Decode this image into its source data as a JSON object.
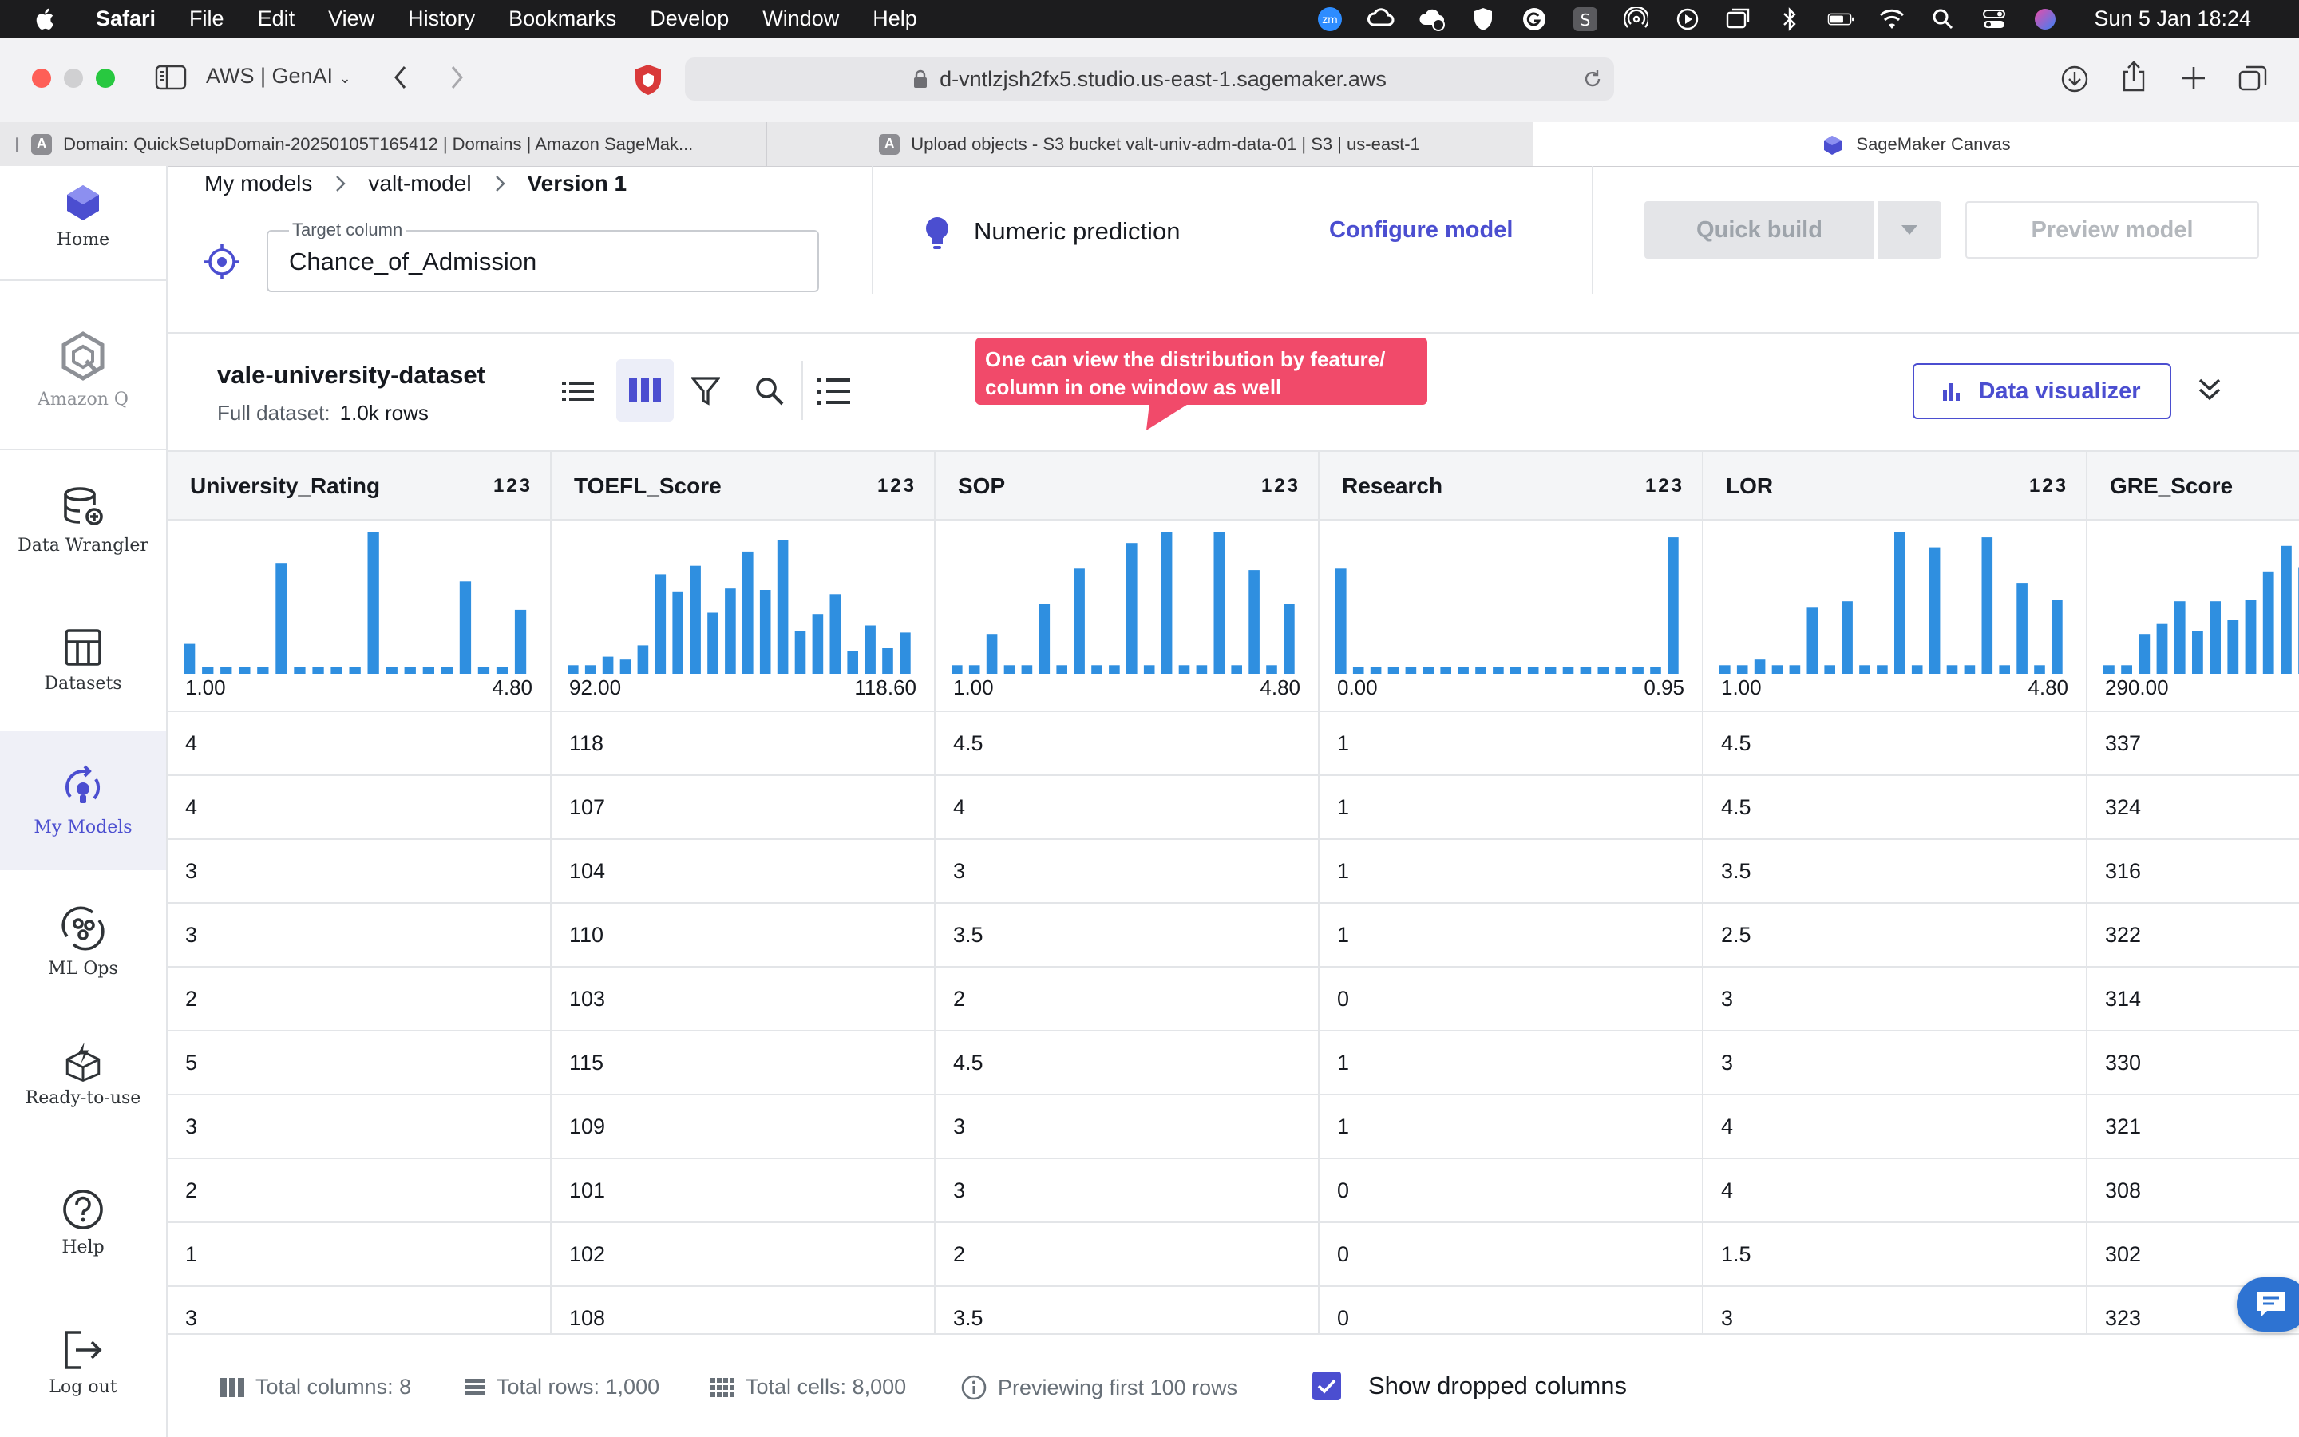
{
  "menubar": {
    "app": "Safari",
    "items": [
      "File",
      "Edit",
      "View",
      "History",
      "Bookmarks",
      "Develop",
      "Window",
      "Help"
    ],
    "clock": "Sun 5 Jan  18:24",
    "zoom_badge": "zm"
  },
  "browser": {
    "tab_group": "AWS | GenAI",
    "url": "d-vntlzjsh2fx5.studio.us-east-1.sagemaker.aws",
    "tabs": [
      {
        "favicon": "A",
        "title": "Domain: QuickSetupDomain-20250105T165412 | Domains | Amazon SageMak..."
      },
      {
        "favicon": "A",
        "title": "Upload objects - S3 bucket valt-univ-adm-data-01 | S3 | us-east-1"
      },
      {
        "favicon": "",
        "title": "SageMaker Canvas"
      }
    ]
  },
  "nav": {
    "items": [
      {
        "label": "Home",
        "icon": "home-icon"
      },
      {
        "label": "Amazon Q",
        "icon": "amazon-q-icon"
      },
      {
        "label": "Data Wrangler",
        "icon": "data-wrangler-icon"
      },
      {
        "label": "Datasets",
        "icon": "datasets-icon"
      },
      {
        "label": "My Models",
        "icon": "my-models-icon"
      },
      {
        "label": "ML Ops",
        "icon": "ml-ops-icon"
      },
      {
        "label": "Ready-to-use",
        "icon": "ready-to-use-icon"
      },
      {
        "label": "Help",
        "icon": "help-icon"
      },
      {
        "label": "Log out",
        "icon": "log-out-icon"
      }
    ]
  },
  "header": {
    "breadcrumb": [
      "My models",
      "valt-model",
      "Version 1"
    ],
    "target_label": "Target column",
    "target_value": "Chance_of_Admission",
    "problem_type": "Numeric prediction",
    "configure": "Configure model",
    "quick_build": "Quick build",
    "preview_model": "Preview model"
  },
  "dataset": {
    "name": "vale-university-dataset",
    "full_label": "Full dataset:",
    "rows": "1.0k rows",
    "callout": "One can view the distribution by feature/ column in one window as well",
    "visualizer": "Data visualizer"
  },
  "columns": [
    {
      "name": "University_Rating",
      "type": "123",
      "min": "1.00",
      "max": "4.80",
      "hist": [
        0.21,
        0.05,
        0.05,
        0.05,
        0.05,
        0.78,
        0.05,
        0.05,
        0.05,
        0.05,
        1.0,
        0.05,
        0.05,
        0.05,
        0.05,
        0.65,
        0.05,
        0.05,
        0.45
      ]
    },
    {
      "name": "TOEFL_Score",
      "type": "123",
      "min": "92.00",
      "max": "118.60",
      "hist": [
        0.06,
        0.06,
        0.12,
        0.1,
        0.2,
        0.7,
        0.58,
        0.76,
        0.43,
        0.6,
        0.86,
        0.59,
        0.94,
        0.3,
        0.42,
        0.56,
        0.16,
        0.34,
        0.18,
        0.29
      ]
    },
    {
      "name": "SOP",
      "type": "123",
      "min": "1.00",
      "max": "4.80",
      "hist": [
        0.06,
        0.06,
        0.28,
        0.06,
        0.06,
        0.49,
        0.06,
        0.74,
        0.06,
        0.06,
        0.92,
        0.06,
        1.0,
        0.06,
        0.06,
        1.0,
        0.06,
        0.73,
        0.06,
        0.49
      ]
    },
    {
      "name": "Research",
      "type": "123",
      "min": "0.00",
      "max": "0.95",
      "hist": [
        0.74,
        0.05,
        0.05,
        0.05,
        0.05,
        0.05,
        0.05,
        0.05,
        0.05,
        0.05,
        0.05,
        0.05,
        0.05,
        0.05,
        0.05,
        0.05,
        0.05,
        0.05,
        0.05,
        0.96
      ]
    },
    {
      "name": "LOR",
      "type": "123",
      "min": "1.00",
      "max": "4.80",
      "hist": [
        0.06,
        0.06,
        0.1,
        0.06,
        0.06,
        0.47,
        0.06,
        0.51,
        0.06,
        0.06,
        1.0,
        0.06,
        0.89,
        0.06,
        0.06,
        0.96,
        0.06,
        0.64,
        0.06,
        0.52
      ]
    },
    {
      "name": "GRE_Score",
      "type": "123",
      "min": "290.00",
      "max": "",
      "hist": [
        0.06,
        0.06,
        0.28,
        0.35,
        0.51,
        0.3,
        0.51,
        0.38,
        0.52,
        0.72,
        0.9,
        0.75,
        0.98
      ]
    }
  ],
  "rows": [
    [
      "4",
      "118",
      "4.5",
      "1",
      "4.5",
      "337"
    ],
    [
      "4",
      "107",
      "4",
      "1",
      "4.5",
      "324"
    ],
    [
      "3",
      "104",
      "3",
      "1",
      "3.5",
      "316"
    ],
    [
      "3",
      "110",
      "3.5",
      "1",
      "2.5",
      "322"
    ],
    [
      "2",
      "103",
      "2",
      "0",
      "3",
      "314"
    ],
    [
      "5",
      "115",
      "4.5",
      "1",
      "3",
      "330"
    ],
    [
      "3",
      "109",
      "3",
      "1",
      "4",
      "321"
    ],
    [
      "2",
      "101",
      "3",
      "0",
      "4",
      "308"
    ],
    [
      "1",
      "102",
      "2",
      "0",
      "1.5",
      "302"
    ],
    [
      "3",
      "108",
      "3.5",
      "0",
      "3",
      "323"
    ]
  ],
  "footer": {
    "total_columns": "Total columns: 8",
    "total_rows": "Total rows: 1,000",
    "total_cells": "Total cells: 8,000",
    "previewing": "Previewing first 100 rows",
    "show_dropped": "Show dropped columns",
    "show_dropped_checked": true
  },
  "colors": {
    "accent": "#4b4ed0",
    "bar": "#2f8fe0",
    "callout": "#f14a6a"
  }
}
